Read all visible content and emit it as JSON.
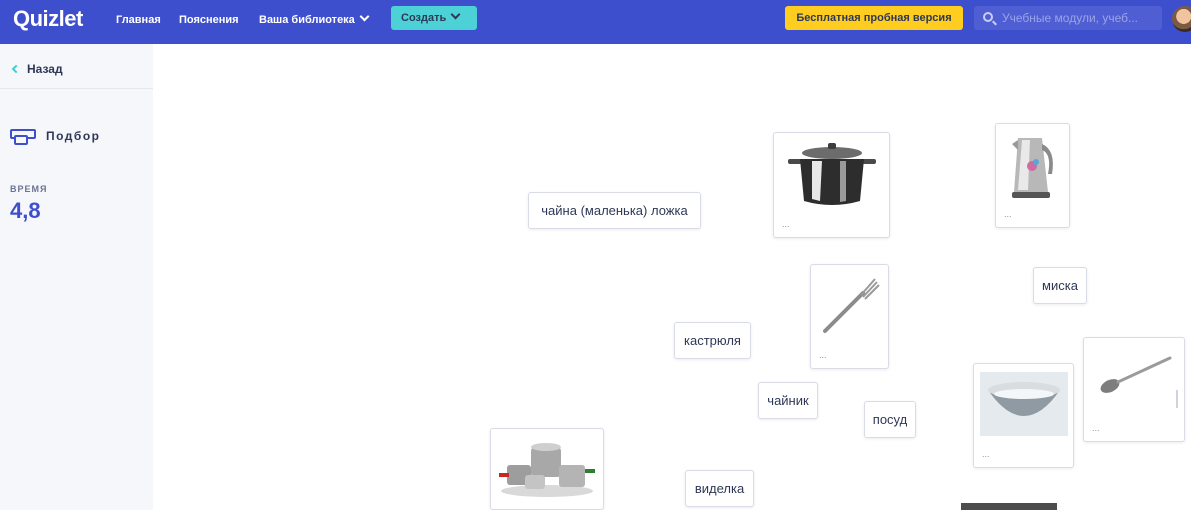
{
  "header": {
    "logo": "Quizlet",
    "nav": {
      "home": "Главная",
      "explanations": "Пояснения",
      "library": "Ваша библиотека"
    },
    "create_label": "Создать",
    "trial_label": "Бесплатная пробная версия",
    "search_placeholder": "Учебные модули, учеб..."
  },
  "sidebar": {
    "back_label": "Назад",
    "mode_label": "Подбор",
    "time_label": "ВРЕМЯ",
    "time_value": "4,8"
  },
  "tiles": {
    "word_spoon": "чайна (маленька) ложка",
    "word_pot": "кастрюля",
    "word_kettle": "чайник",
    "word_dishes": "посуд",
    "word_bowl": "миска",
    "word_fork": "виделка",
    "img_dots": "..."
  },
  "colors": {
    "brand": "#3e4fcd",
    "accent": "#4bd1d6",
    "trial": "#ffcd1f"
  },
  "icons": {
    "search": "magnifier-icon",
    "back": "chevron-left-icon",
    "mode": "match-cards-icon",
    "dropdown": "chevron-down-icon"
  }
}
